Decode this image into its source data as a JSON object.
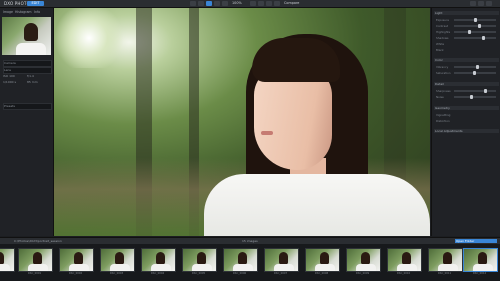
{
  "app": {
    "brand": "DXO PHOTOLAB",
    "mode_tab": "EDIT"
  },
  "toolbar": {
    "zoom_label": "100%",
    "compare_label": "Compare"
  },
  "left_panel": {
    "tabs": [
      "Image",
      "Histogram",
      "Info"
    ],
    "fields": [
      "Camera",
      "Lens",
      "ISO 100",
      "f/1.4",
      "1/1000 s",
      "85 mm"
    ],
    "preset_label": "Presets"
  },
  "right_panel": {
    "sections": [
      "Light",
      "Color",
      "Detail",
      "Geometry",
      "Local Adjustments"
    ],
    "rows": [
      "Exposure",
      "Contrast",
      "Highlights",
      "Shadows",
      "White",
      "Black",
      "Vibrancy",
      "Saturation",
      "Sharpness",
      "Noise",
      "Vignetting",
      "Distortion"
    ]
  },
  "filmstrip": {
    "path": "C:\\Photos\\2023\\portrait_session",
    "count": "15 images",
    "folder_button": "Open Folder",
    "items": [
      "DSC_0001",
      "DSC_0002",
      "DSC_0003",
      "DSC_0004",
      "DSC_0005",
      "DSC_0006",
      "DSC_0007",
      "DSC_0008",
      "DSC_0009",
      "DSC_0010",
      "DSC_0011",
      "DSC_0012"
    ]
  },
  "colors": {
    "accent": "#3a86d6",
    "panel": "#202226",
    "topbar": "#2a2d31"
  }
}
